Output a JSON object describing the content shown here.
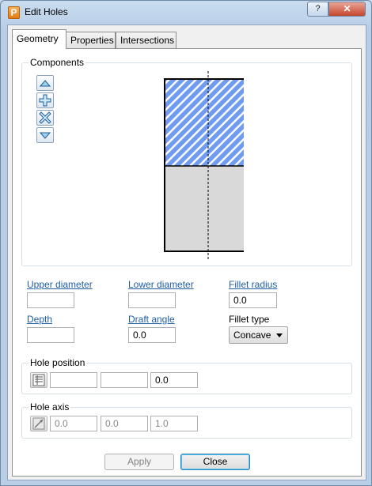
{
  "window": {
    "title": "Edit Holes",
    "app_icon_letter": "P",
    "help_label": "?",
    "close_label": "✕"
  },
  "tabs": [
    {
      "label": "Geometry",
      "active": true
    },
    {
      "label": "Properties",
      "active": false
    },
    {
      "label": "Intersections",
      "active": false
    }
  ],
  "components": {
    "label": "Components",
    "tools": [
      "move-up-icon",
      "add-component-icon",
      "remove-component-icon",
      "move-down-icon"
    ],
    "preview_colors": {
      "upper": "#6f9bf0",
      "hatch": "#ffffff",
      "lower": "#d9d9d9"
    }
  },
  "parameters": {
    "upper_diameter": {
      "label": "Upper diameter",
      "value": ""
    },
    "lower_diameter": {
      "label": "Lower diameter",
      "value": ""
    },
    "fillet_radius": {
      "label": "Fillet radius",
      "value": "0.0"
    },
    "depth": {
      "label": "Depth",
      "value": ""
    },
    "draft_angle": {
      "label": "Draft angle",
      "value": "0.0"
    },
    "fillet_type": {
      "label": "Fillet type",
      "value": "Concave"
    }
  },
  "hole_position": {
    "label": "Hole position",
    "icon": "position-list-icon",
    "values": [
      "",
      "",
      "0.0"
    ]
  },
  "hole_axis": {
    "label": "Hole axis",
    "icon": "axis-icon",
    "values": [
      "0.0",
      "0.0",
      "1.0"
    ]
  },
  "buttons": {
    "apply": "Apply",
    "close": "Close"
  }
}
